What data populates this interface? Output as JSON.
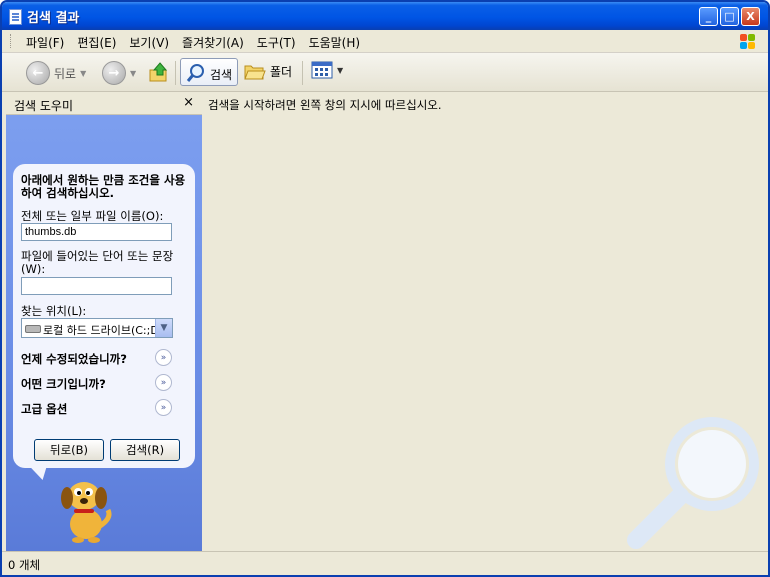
{
  "window": {
    "title": "검색 결과"
  },
  "title_buttons": {
    "minimize": "_",
    "maximize": "□",
    "close": "X"
  },
  "menu": [
    "파일(F)",
    "편집(E)",
    "보기(V)",
    "즐겨찾기(A)",
    "도구(T)",
    "도움말(H)"
  ],
  "toolbar": {
    "back": "뒤로",
    "search": "검색",
    "folders": "폴더"
  },
  "sidebar": {
    "title": "검색 도우미",
    "close": "×",
    "prompt": "아래에서 원하는 만큼 조건을 사용하여 검색하십시오.",
    "name_label": "전체 또는 일부 파일 이름(O):",
    "name_value": "thumbs.db",
    "phrase_label": "파일에 들어있는 단어 또는 문장(W):",
    "phrase_value": "",
    "location_label": "찾는 위치(L):",
    "location_value": "로컬 하드 드라이브(C:;D:)",
    "when_modified": "언제 수정되었습니까?",
    "what_size": "어떤 크기입니까?",
    "advanced": "고급 옵션",
    "back_button": "뒤로(B)",
    "search_button": "검색(R)"
  },
  "main": {
    "instruction": "검색을 시작하려면 왼쪽 창의 지시에 따르십시오."
  },
  "status": {
    "count": "0 개체"
  }
}
